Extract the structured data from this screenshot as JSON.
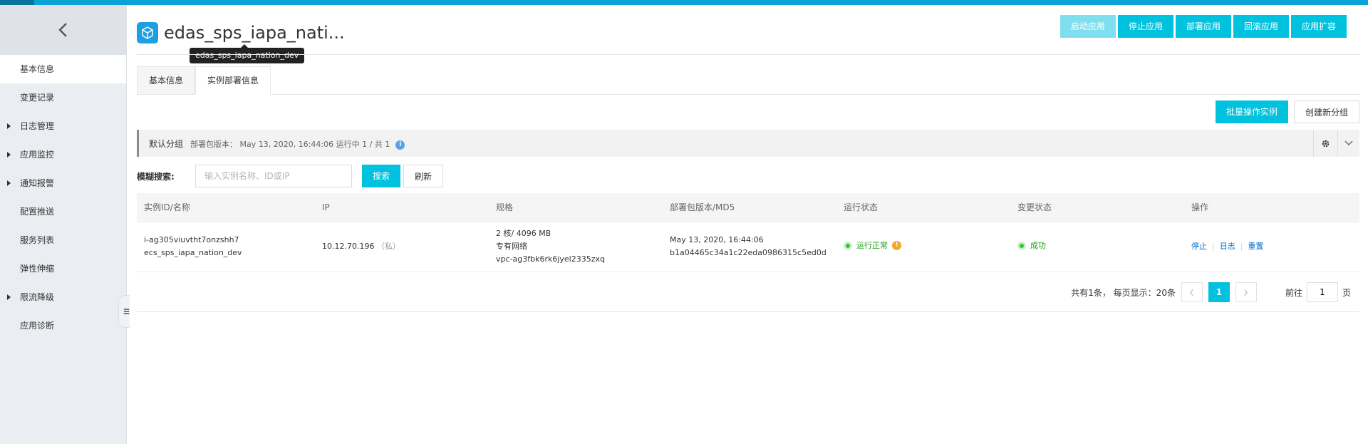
{
  "sidebar": {
    "back_icon": "chevron-left-icon",
    "items": [
      {
        "label": "基本信息",
        "active": true,
        "expandable": false
      },
      {
        "label": "变更记录",
        "active": false,
        "expandable": false
      },
      {
        "label": "日志管理",
        "active": false,
        "expandable": true
      },
      {
        "label": "应用监控",
        "active": false,
        "expandable": true
      },
      {
        "label": "通知报警",
        "active": false,
        "expandable": true
      },
      {
        "label": "配置推送",
        "active": false,
        "expandable": false
      },
      {
        "label": "服务列表",
        "active": false,
        "expandable": false
      },
      {
        "label": "弹性伸缩",
        "active": false,
        "expandable": false
      },
      {
        "label": "限流降级",
        "active": false,
        "expandable": true
      },
      {
        "label": "应用诊断",
        "active": false,
        "expandable": false
      }
    ]
  },
  "header": {
    "title": "edas_sps_iapa_nati...",
    "tooltip": "edas_sps_iapa_nation_dev",
    "actions": {
      "start": "启动应用",
      "stop": "停止应用",
      "deploy": "部署应用",
      "rollback": "回滚应用",
      "scale": "应用扩容"
    }
  },
  "tabs": {
    "basic": "基本信息",
    "instances": "实例部署信息"
  },
  "group_actions": {
    "batch": "批量操作实例",
    "create_group": "创建新分组"
  },
  "group": {
    "name": "默认分组",
    "info": "部署包版本：  May 13, 2020, 16:44:06     运行中 1 / 共 1"
  },
  "search": {
    "label": "模糊搜索:",
    "placeholder": "输入实例名称、ID或IP",
    "search_btn": "搜索",
    "refresh_btn": "刷新"
  },
  "table": {
    "headers": {
      "id": "实例ID/名称",
      "ip": "IP",
      "spec": "规格",
      "version": "部署包版本/MD5",
      "run_status": "运行状态",
      "change_status": "变更状态",
      "ops": "操作"
    },
    "row": {
      "id": "i-ag305viuvtht7onzshh7",
      "name": "ecs_sps_iapa_nation_dev",
      "ip": "10.12.70.196",
      "ip_tag": "（私）",
      "spec_cpu_mem": "2 核/ 4096 MB",
      "network": "专有网络",
      "vpc": "vpc-ag3fbk6rk6jyel2335zxq",
      "version": "May 13, 2020, 16:44:06",
      "md5": "b1a04465c34a1c22eda0986315c5ed0d",
      "run_status": "运行正常",
      "change_status": "成功",
      "op_stop": "停止",
      "op_log": "日志",
      "op_reset": "重置"
    }
  },
  "pager": {
    "summary": "共有1条，  每页显示：20条",
    "current_page": "1",
    "goto_prefix": "前往",
    "goto_value": "1",
    "goto_suffix": "页"
  },
  "colors": {
    "accent": "#00c1de",
    "topbar": "#0aa3d6",
    "success": "#1e9b1e",
    "warning": "#f5a623",
    "link": "#0070cc"
  }
}
